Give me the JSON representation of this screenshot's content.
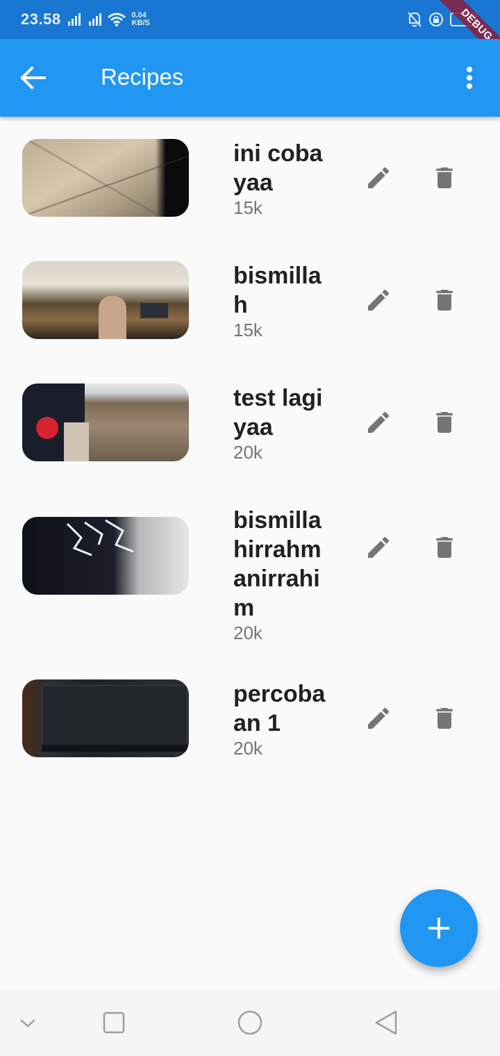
{
  "status_bar": {
    "time": "23.58",
    "network_speed_value": "0.04",
    "network_speed_unit": "KB/S",
    "debug_banner": "DEBUG"
  },
  "app_bar": {
    "title": "Recipes",
    "back_icon": "arrow-back-icon",
    "menu_icon": "more-vert-icon",
    "color": "#2196f3"
  },
  "recipes": [
    {
      "title": "ini coba yaa",
      "price": "15k"
    },
    {
      "title": "bismillah",
      "price": "15k"
    },
    {
      "title": "test lagi yaa",
      "price": "20k"
    },
    {
      "title": "bismillahirrahmanirrahim",
      "price": "20k"
    },
    {
      "title": "percobaan 1",
      "price": "20k"
    }
  ],
  "actions": {
    "edit_icon": "pencil-icon",
    "delete_icon": "trash-icon",
    "icon_color": "#757575"
  },
  "fab": {
    "icon": "plus-icon",
    "color": "#2196f3"
  },
  "nav_bar": {
    "icons": [
      "chevron-down-icon",
      "square-icon",
      "circle-icon",
      "triangle-back-icon"
    ]
  }
}
